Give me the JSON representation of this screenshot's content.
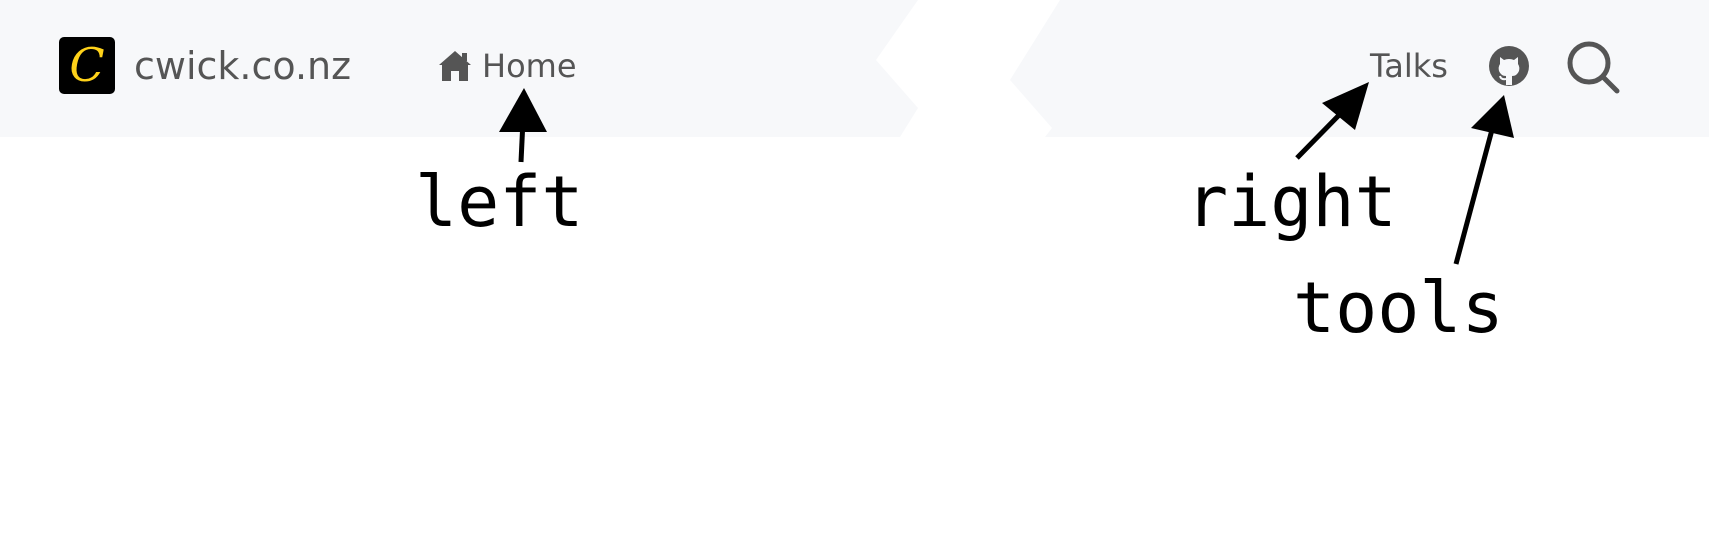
{
  "navbar": {
    "logo_letter": "C",
    "site_title": "cwick.co.nz",
    "home_label": "Home",
    "talks_label": "Talks",
    "icons": {
      "logo": "logo-c-icon",
      "home": "home-icon",
      "github": "github-icon",
      "search": "search-icon"
    },
    "colors": {
      "navbar_bg": "#f7f8fa",
      "text": "#555555",
      "logo_bg": "#000000",
      "logo_letter": "#ffd21a"
    }
  },
  "annotations": {
    "left": "left",
    "right": "right",
    "tools": "tools"
  }
}
